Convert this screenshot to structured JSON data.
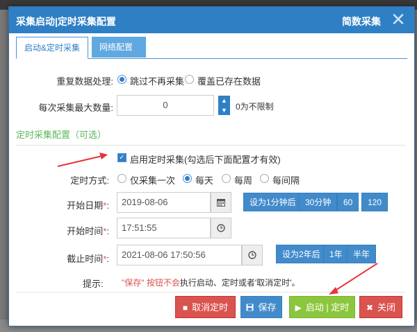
{
  "dialog": {
    "title": "采集启动|定时采集配置",
    "subtitle": "简数采集",
    "close_icon": "close-icon"
  },
  "tabs": [
    {
      "label": "启动&定时采集",
      "active": true
    },
    {
      "label": "网络配置",
      "active": false
    }
  ],
  "duplicate": {
    "label": "重复数据处理:",
    "options": [
      "跳过不再采集",
      "覆盖已存在数据"
    ],
    "selected": 0
  },
  "max_count": {
    "label": "每次采集最大数量:",
    "value": "0",
    "note": "0为不限制"
  },
  "schedule_section": {
    "title": "定时采集配置（可选）",
    "enable_label": "启用定时采集(勾选后下面配置才有效)",
    "enabled": true
  },
  "schedule_mode": {
    "label": "定时方式:",
    "options": [
      "仅采集一次",
      "每天",
      "每周",
      "每间隔"
    ],
    "selected": 1
  },
  "start_date": {
    "label": "开始日期",
    "value": "2019-08-06",
    "quick_buttons": [
      "设为1分钟后",
      "30分钟",
      "60",
      "120"
    ]
  },
  "start_time": {
    "label": "开始时间",
    "value": "17:51:55"
  },
  "end_time": {
    "label": "截止时间",
    "value": "2021-08-06 17:50:56",
    "quick_buttons": [
      "设为2年后",
      "1年",
      "半年"
    ]
  },
  "hint": {
    "label": "提示:",
    "highlight": "\"保存\" 按钮不会",
    "text": "执行启动、定时或者'取消定时'。"
  },
  "footer": {
    "cancel_schedule": "取消定时",
    "save": "保存",
    "start": "启动 | 定时",
    "close": "关闭"
  },
  "colors": {
    "accent": "#2f7fc5",
    "cancel": "#d9534f",
    "save": "#428bca",
    "start": "#8cc63f",
    "close": "#d9534f",
    "section": "#5cb85c",
    "arrow": "#e8333a"
  }
}
